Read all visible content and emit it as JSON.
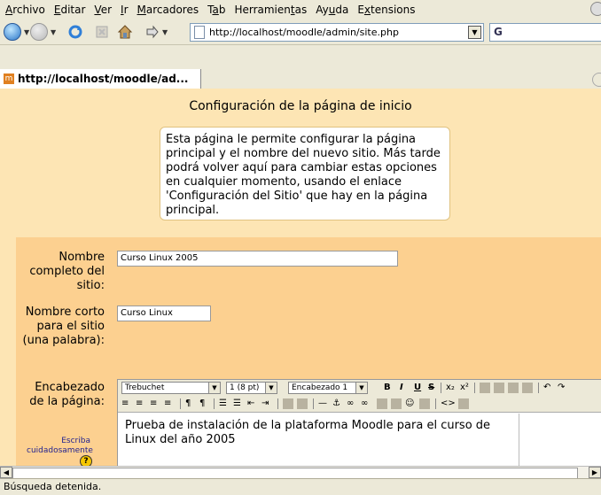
{
  "menu": [
    "Archivo",
    "Editar",
    "Ver",
    "Ir",
    "Marcadores",
    "Tab",
    "Herramientas",
    "Ayuda",
    "Extensions"
  ],
  "menu_accel": [
    "A",
    "E",
    "V",
    "I",
    "M",
    "a",
    "t",
    "u",
    "x"
  ],
  "address": {
    "url": "http://localhost/moodle/admin/site.php"
  },
  "search_box": {
    "label": "G"
  },
  "tab": {
    "title": "http://localhost/moodle/ad..."
  },
  "page": {
    "heading": "Configuración de la página de inicio",
    "info": "Esta página le permite configurar la página principal y el nombre del nuevo sitio. Más tarde podrá volver aquí para cambiar estas opciones en cualquier momento, usando el enlace 'Configuración del Sitio' que hay en la página principal."
  },
  "form": {
    "fullname_label": "Nombre completo del sitio:",
    "fullname_value": "Curso Linux 2005",
    "shortname_label": "Nombre corto para el sitio (una palabra):",
    "shortname_value": "Curso Linux",
    "header_label": "Encabezado de la página:",
    "help_text": "Escriba cuidadosamente",
    "help_icon": "?"
  },
  "editor": {
    "font": "Trebuchet",
    "size": "1 (8 pt)",
    "format": "Encabezado 1",
    "content": "Prueba de instalación de la plataforma Moodle para el curso de Linux del año 2005"
  },
  "status": {
    "text": "Búsqueda detenida."
  }
}
